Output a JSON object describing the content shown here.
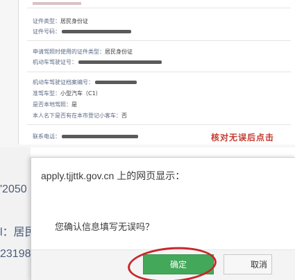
{
  "form": {
    "cert_type_label": "证件类型：",
    "cert_type_value": "居民身份证",
    "cert_no_label": "证件号码：",
    "license_cert_type_label": "申请驾照时使用的证件类型：",
    "license_cert_type_value": "居民身份证",
    "license_cert_no_label": "机动车驾驶证号：",
    "file_no_label": "机动车驾驶证档案编号：",
    "vehicle_type_label": "准驾车型：",
    "vehicle_type_value": "小型汽车（C1）",
    "local_license_label": "是否本地驾照：",
    "local_license_value": "是",
    "registered_label": "本人名下是否有在本市登记小客车：",
    "registered_value": "否",
    "phone_label": "联系电话：",
    "hint_text": "核对无误后点击"
  },
  "background": {
    "text_a": "'2050",
    "text_b": "l：居民",
    "text_c": "23198"
  },
  "dialog": {
    "title": "apply.tjjttk.gov.cn 上的网页显示：",
    "message": "您确认信息填写无误吗？",
    "ok_label": "确定",
    "cancel_label": "取消"
  },
  "colors": {
    "ok_button": "#43a85a",
    "annotation_circle": "#c8272b",
    "hint_text": "#c33a2e"
  }
}
